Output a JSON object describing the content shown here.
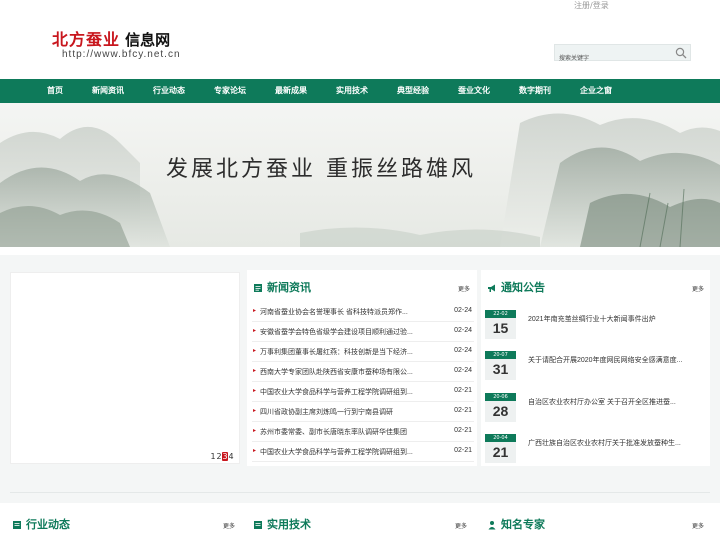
{
  "top": {
    "login_link": "注册/登录"
  },
  "logo": {
    "red_text": "北方蚕业",
    "black_text": "信息网",
    "url": "http://www.bfcy.net.cn"
  },
  "search": {
    "placeholder": "搜索关键字",
    "icon": "search-icon"
  },
  "nav": {
    "items": [
      "首页",
      "新闻资讯",
      "行业动态",
      "专家论坛",
      "最新成果",
      "实用技术",
      "典型经验",
      "蚕业文化",
      "数字期刊",
      "企业之窗"
    ]
  },
  "banner": {
    "slogan": "发展北方蚕业    重振丝路雄风"
  },
  "slider": {
    "dots": [
      "1",
      "2",
      "3",
      "4"
    ],
    "active_dot": "3"
  },
  "news": {
    "title": "新闻资讯",
    "more": "更多",
    "items": [
      {
        "title": "河南省蚕业协会名誉理事长 省科技特派员郑作...",
        "date": "02-24"
      },
      {
        "title": "安徽省蚕学会特色省级学会建设项目顺利通过验...",
        "date": "02-24"
      },
      {
        "title": "万事利集团董事长屠红燕：科技创新是当下经济...",
        "date": "02-24"
      },
      {
        "title": "西南大学专家团队赴陕西省安康市蚕种场有限公...",
        "date": "02-24"
      },
      {
        "title": "中国农业大学食品科学与营养工程学院调研组到...",
        "date": "02-21"
      },
      {
        "title": "四川省政协副主席刘炼鸣一行到宁南县调研",
        "date": "02-21"
      },
      {
        "title": "苏州市委常委、副市长唐晓东率队调研华佳集团",
        "date": "02-21"
      },
      {
        "title": "中国农业大学食品科学与营养工程学院调研组到...",
        "date": "02-21"
      }
    ]
  },
  "notice": {
    "title": "通知公告",
    "more": "更多",
    "items": [
      {
        "ym": "22-02",
        "day": "15",
        "title": "2021年南充茧丝绸行业十大新闻事件出炉"
      },
      {
        "ym": "20-07",
        "day": "31",
        "title": "关于请配合开展2020年度网民网络安全感满意度..."
      },
      {
        "ym": "20-06",
        "day": "28",
        "title": "自治区农业农村厅办公室 关于召开全区推进蚕..."
      },
      {
        "ym": "20-04",
        "day": "21",
        "title": "广西壮族自治区农业农村厅关于批准发放蚕种生..."
      }
    ]
  },
  "bottom_sections": [
    {
      "title": "行业动态",
      "more": "更多"
    },
    {
      "title": "实用技术",
      "more": "更多"
    },
    {
      "title": "知名专家",
      "more": "更多"
    }
  ],
  "colors": {
    "brand_green": "#0e7a5a",
    "logo_red": "#c8161d"
  }
}
